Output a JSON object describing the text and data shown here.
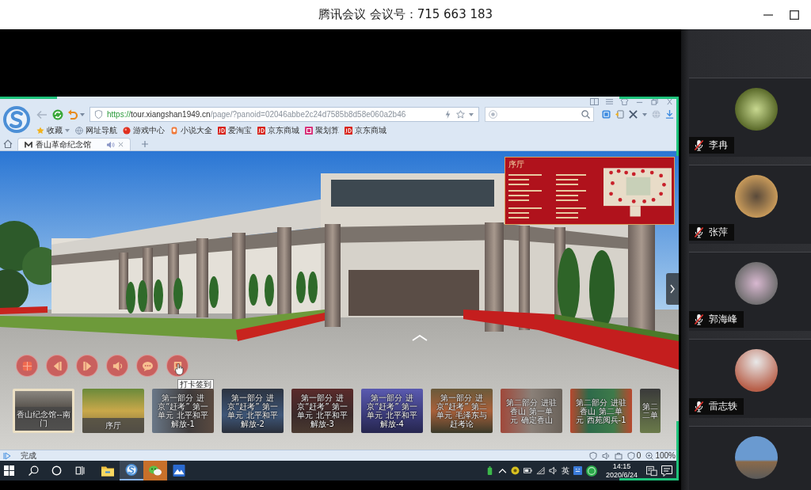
{
  "window": {
    "title": "腾讯会议 会议号：715 663 183"
  },
  "browser": {
    "url": {
      "scheme": "https://",
      "host": "tour.xiangshan1949.cn",
      "path": "/page/?panoid=02046abbe2c24d7585b8d58e060a2b46"
    },
    "bookmarks": [
      {
        "label": "收藏",
        "kind": "star"
      },
      {
        "label": "网址导航",
        "kind": "globe"
      },
      {
        "label": "游戏中心",
        "kind": "game"
      },
      {
        "label": "小说大全",
        "kind": "novel"
      },
      {
        "label": "爱淘宝",
        "kind": "shop"
      },
      {
        "label": "京东商城",
        "kind": "shop"
      },
      {
        "label": "聚划算",
        "kind": "deal"
      },
      {
        "label": "京东商城",
        "kind": "shop"
      }
    ],
    "tabs": [
      {
        "label": "香山革命纪念馆",
        "selected": true
      }
    ],
    "status": "完成",
    "blocked_count": "0",
    "zoom": "100%"
  },
  "tour": {
    "map": {
      "title": "序厅"
    },
    "tooltip": "打卡签到",
    "scenes": [
      {
        "label": "香山纪念馆--南门",
        "kind": "strip",
        "selected": true
      },
      {
        "label": "序厅",
        "kind": "strip",
        "selected": false
      },
      {
        "label": "第一部分 进京“赶考” 第一单元 北平和平解放-1",
        "kind": "overlay",
        "selected": false
      },
      {
        "label": "第一部分 进京“赶考” 第一单元 北平和平解放-2",
        "kind": "overlay",
        "selected": false
      },
      {
        "label": "第一部分 进京“赶考” 第一单元 北平和平解放-3",
        "kind": "overlay",
        "selected": false
      },
      {
        "label": "第一部分 进京“赶考” 第一单元 北平和平解放-4",
        "kind": "overlay",
        "selected": false
      },
      {
        "label": "第一部分 进京“赶考” 第二单元 毛泽东与赶考论",
        "kind": "overlay",
        "selected": false
      },
      {
        "label": "第二部分 进驻香山 第一单元 确定香山",
        "kind": "overlay",
        "selected": false
      },
      {
        "label": "第二部分 进驻香山 第二单元 西苑阅兵-1",
        "kind": "overlay",
        "selected": false
      },
      {
        "label": "第二二单",
        "kind": "cut",
        "selected": false
      }
    ]
  },
  "taskbar": {
    "apps": [
      {
        "kind": "explorer",
        "active": false,
        "attention": false
      },
      {
        "kind": "browser",
        "active": true,
        "attention": false
      },
      {
        "kind": "chat",
        "active": false,
        "attention": true
      },
      {
        "kind": "remote",
        "active": false,
        "attention": false
      }
    ],
    "ime": "英",
    "time": "14:15",
    "date": "2020/6/24"
  },
  "participants": [
    {
      "name": "李冉",
      "muted": true
    },
    {
      "name": "张萍",
      "muted": true
    },
    {
      "name": "郭海峰",
      "muted": true
    },
    {
      "name": "雷志轶",
      "muted": true
    }
  ]
}
